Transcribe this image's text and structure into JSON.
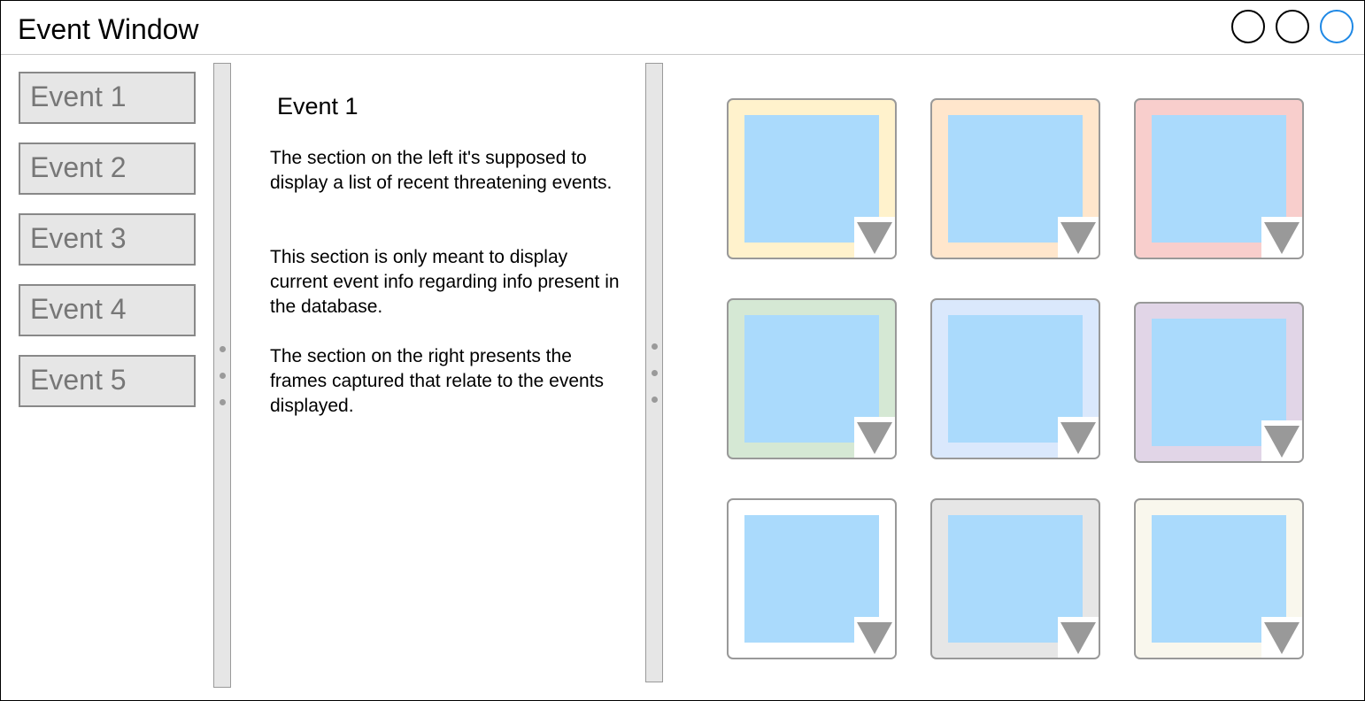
{
  "window": {
    "title": "Event Window",
    "controls": [
      {
        "name": "window-control-1",
        "color": "#000000"
      },
      {
        "name": "window-control-2",
        "color": "#000000"
      },
      {
        "name": "window-control-3",
        "color": "#1e88e5"
      }
    ]
  },
  "events": [
    {
      "label": "Event 1"
    },
    {
      "label": "Event 2"
    },
    {
      "label": "Event 3"
    },
    {
      "label": "Event 4"
    },
    {
      "label": "Event 5"
    }
  ],
  "detail": {
    "title": "Event 1",
    "paragraphs": [
      "The section on the left it's supposed to display a list of recent threatening events.",
      "This section is only meant to display current event info regarding info present in the database.",
      "The section on the right presents the frames captured that relate to the events displayed."
    ]
  },
  "frames": [
    {
      "border_color": "#fff2cc",
      "image_color": "#aadafc",
      "menu_icon": "triangle-down-icon"
    },
    {
      "border_color": "#ffe6cc",
      "image_color": "#aadafc",
      "menu_icon": "triangle-down-icon"
    },
    {
      "border_color": "#f8cecc",
      "image_color": "#aadafc",
      "menu_icon": "triangle-down-icon"
    },
    {
      "border_color": "#d5e8d4",
      "image_color": "#aadafc",
      "menu_icon": "triangle-down-icon"
    },
    {
      "border_color": "#dae8fc",
      "image_color": "#aadafc",
      "menu_icon": "triangle-down-icon"
    },
    {
      "border_color": "#e1d5e7",
      "image_color": "#aadafc",
      "menu_icon": "triangle-down-icon"
    },
    {
      "border_color": "#ffffff",
      "image_color": "#aadafc",
      "menu_icon": "triangle-down-icon"
    },
    {
      "border_color": "#e6e6e6",
      "image_color": "#aadafc",
      "menu_icon": "triangle-down-icon"
    },
    {
      "border_color": "#f9f7ed",
      "image_color": "#aadafc",
      "menu_icon": "triangle-down-icon"
    }
  ]
}
